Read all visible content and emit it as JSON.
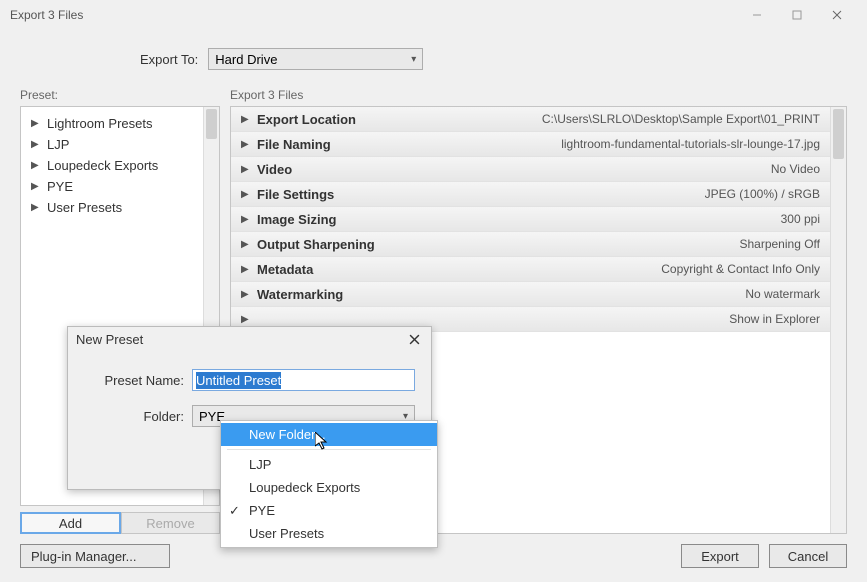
{
  "window": {
    "title": "Export 3 Files"
  },
  "export_to": {
    "label": "Export To:",
    "value": "Hard Drive"
  },
  "preset_panel": {
    "label": "Preset:",
    "items": [
      {
        "label": "Lightroom Presets"
      },
      {
        "label": "LJP"
      },
      {
        "label": "Loupedeck Exports"
      },
      {
        "label": "PYE"
      },
      {
        "label": "User Presets"
      }
    ],
    "add_label": "Add",
    "remove_label": "Remove"
  },
  "sections_panel": {
    "label": "Export 3 Files",
    "rows": [
      {
        "name": "Export Location",
        "value": "C:\\Users\\SLRLO\\Desktop\\Sample Export\\01_PRINT"
      },
      {
        "name": "File Naming",
        "value": "lightroom-fundamental-tutorials-slr-lounge-17.jpg"
      },
      {
        "name": "Video",
        "value": "No Video"
      },
      {
        "name": "File Settings",
        "value": "JPEG (100%) / sRGB"
      },
      {
        "name": "Image Sizing",
        "value": "300 ppi"
      },
      {
        "name": "Output Sharpening",
        "value": "Sharpening Off"
      },
      {
        "name": "Metadata",
        "value": "Copyright & Contact Info Only"
      },
      {
        "name": "Watermarking",
        "value": "No watermark"
      },
      {
        "name": "",
        "value": "Show in Explorer"
      }
    ]
  },
  "footer": {
    "plugin_label": "Plug-in Manager...",
    "export_label": "Export",
    "cancel_label": "Cancel"
  },
  "new_preset_modal": {
    "title": "New Preset",
    "name_label": "Preset Name:",
    "name_value": "Untitled Preset",
    "folder_label": "Folder:",
    "folder_value": "PYE"
  },
  "folder_dropdown": {
    "new_folder_label": "New Folder...",
    "options": [
      {
        "label": "LJP",
        "checked": false
      },
      {
        "label": "Loupedeck Exports",
        "checked": false
      },
      {
        "label": "PYE",
        "checked": true
      },
      {
        "label": "User Presets",
        "checked": false
      }
    ]
  }
}
